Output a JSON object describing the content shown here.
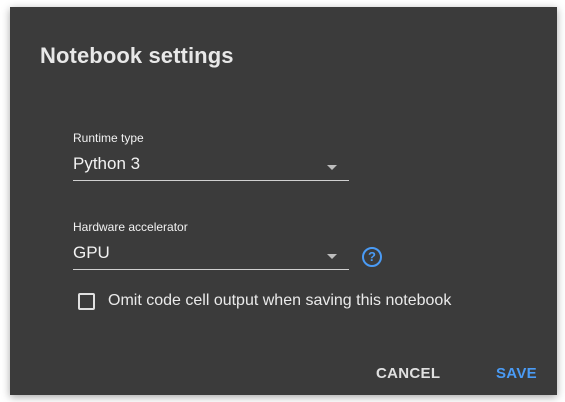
{
  "dialog": {
    "title": "Notebook settings",
    "runtime": {
      "label": "Runtime type",
      "value": "Python 3"
    },
    "accelerator": {
      "label": "Hardware accelerator",
      "value": "GPU",
      "help_icon": "help-circle-icon"
    },
    "omit_output": {
      "label": "Omit code cell output when saving this notebook",
      "checked": false
    },
    "buttons": {
      "cancel": "CANCEL",
      "save": "SAVE"
    },
    "colors": {
      "background": "#3b3b3b",
      "accent": "#4a9bf5",
      "text": "#f2f2f2"
    }
  }
}
